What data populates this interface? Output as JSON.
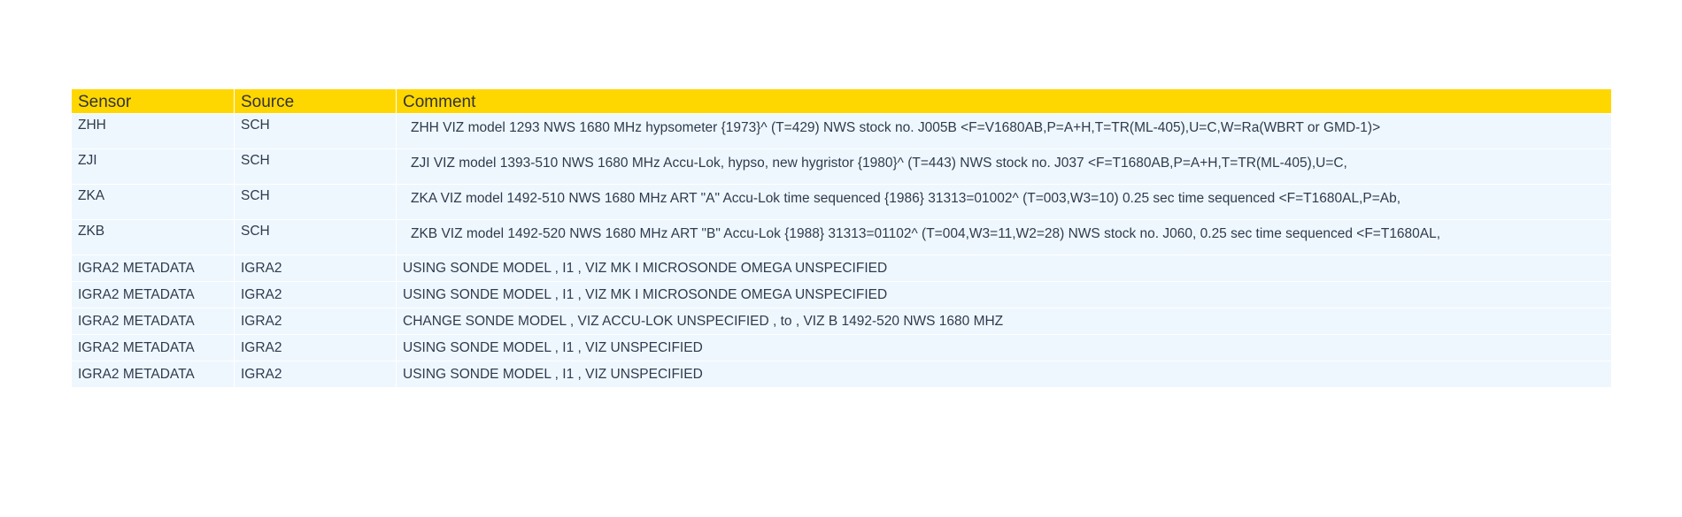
{
  "table": {
    "headers": [
      "Sensor",
      "Source",
      "Comment"
    ],
    "rows": [
      {
        "sensor": "ZHH",
        "source": "SCH",
        "comment": "ZHH VIZ model 1293 NWS 1680 MHz hypsometer {1973}^ (T=429) NWS stock no. J005B <F=V1680AB,P=A+H,T=TR(ML-405),U=C,W=Ra(WBRT or GMD-1)>"
      },
      {
        "sensor": "ZJI",
        "source": "SCH",
        "comment": "ZJI VIZ model 1393-510 NWS 1680 MHz Accu-Lok, hypso, new hygristor {1980}^ (T=443) NWS stock no. J037 <F=T1680AB,P=A+H,T=TR(ML-405),U=C,"
      },
      {
        "sensor": "ZKA",
        "source": "SCH",
        "comment": "ZKA VIZ model 1492-510 NWS 1680 MHz ART \"A\" Accu-Lok time sequenced {1986} 31313=01002^ (T=003,W3=10) 0.25 sec time sequenced <F=T1680AL,P=Ab,"
      },
      {
        "sensor": "ZKB",
        "source": "SCH",
        "comment": "ZKB VIZ model 1492-520 NWS 1680 MHz ART \"B\" Accu-Lok {1988} 31313=01102^ (T=004,W3=11,W2=28) NWS stock no. J060, 0.25 sec time sequenced <F=T1680AL,"
      },
      {
        "sensor": "IGRA2 METADATA",
        "source": "IGRA2",
        "comment": "USING SONDE MODEL , I1 , VIZ MK I MICROSONDE OMEGA UNSPECIFIED"
      },
      {
        "sensor": "IGRA2 METADATA",
        "source": "IGRA2",
        "comment": "USING SONDE MODEL , I1 , VIZ MK I MICROSONDE OMEGA UNSPECIFIED"
      },
      {
        "sensor": "IGRA2 METADATA",
        "source": "IGRA2",
        "comment": "CHANGE SONDE MODEL , VIZ ACCU-LOK UNSPECIFIED , to , VIZ B 1492-520 NWS 1680 MHZ"
      },
      {
        "sensor": "IGRA2 METADATA",
        "source": "IGRA2",
        "comment": "USING SONDE MODEL , I1 , VIZ UNSPECIFIED"
      },
      {
        "sensor": "IGRA2 METADATA",
        "source": "IGRA2",
        "comment": "USING SONDE MODEL , I1 , VIZ UNSPECIFIED"
      }
    ]
  },
  "colors": {
    "header_bg": "#ffd700",
    "row_bg": "#eff7fe",
    "text": "#2e3b4e"
  }
}
